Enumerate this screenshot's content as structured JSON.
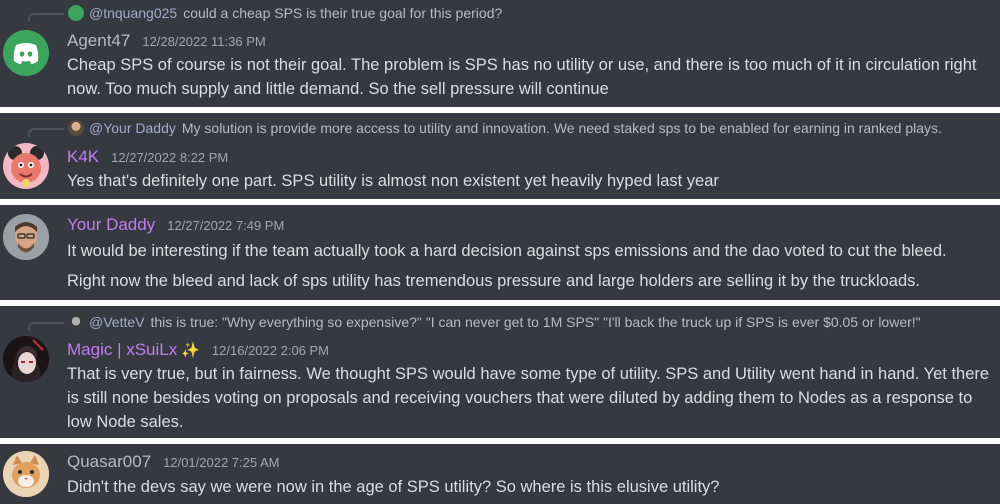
{
  "messages": [
    {
      "reply": {
        "user": "@tnquang025",
        "text": "could a cheap SPS is their true goal for this period?"
      },
      "author": "Agent47",
      "time": "12/28/2022 11:36 PM",
      "lines": [
        "Cheap SPS of course is not their goal. The problem is SPS has no utility or use, and there is too much of it in circulation right now. Too much supply and little demand. So the sell pressure will continue"
      ]
    },
    {
      "reply": {
        "user": "@Your Daddy",
        "text": "My solution is provide more access to utility and innovation. We need staked sps to be enabled for earning in ranked plays."
      },
      "author": "K4K",
      "time": "12/27/2022 8:22 PM",
      "lines": [
        "Yes that's definitely one part. SPS utility is almost non existent yet heavily hyped last year"
      ]
    },
    {
      "author": "Your Daddy",
      "time": "12/27/2022 7:49 PM",
      "lines": [
        "It would be interesting if the team actually took a hard decision against sps emissions and the dao voted to cut the bleed.",
        "Right now the bleed and lack of sps utility has tremendous pressure and large holders are selling it by the truckloads."
      ]
    },
    {
      "reply": {
        "user": "@VetteV",
        "text": "this is true:  \"Why everything so expensive?\"  \"I can never get to 1M SPS\"  \"I'll back the truck up if SPS is ever $0.05 or lower!\""
      },
      "author": "Magic | xSuiLx",
      "author_badge": "✨",
      "time": "12/16/2022 2:06 PM",
      "lines": [
        "That is very true, but in fairness. We thought SPS would have some type of utility. SPS and Utility went hand in hand. Yet there is still none besides voting on proposals and receiving vouchers that were diluted by adding them to Nodes as a response to low Node sales."
      ]
    },
    {
      "author": "Quasar007",
      "time": "12/01/2022 7:25 AM",
      "lines": [
        "Didn't the devs say we were now in the age of SPS utility? So where is this elusive utility?"
      ]
    }
  ],
  "colors": {
    "background": "#36393f",
    "separator": "#ffffff",
    "name_default": "#b9bbbe",
    "name_purple": "#c27cf0",
    "discord_blurple": "#3ba55c"
  },
  "icons": [
    "discord-logo-icon",
    "reply-spine-icon",
    "sparkles-icon"
  ]
}
